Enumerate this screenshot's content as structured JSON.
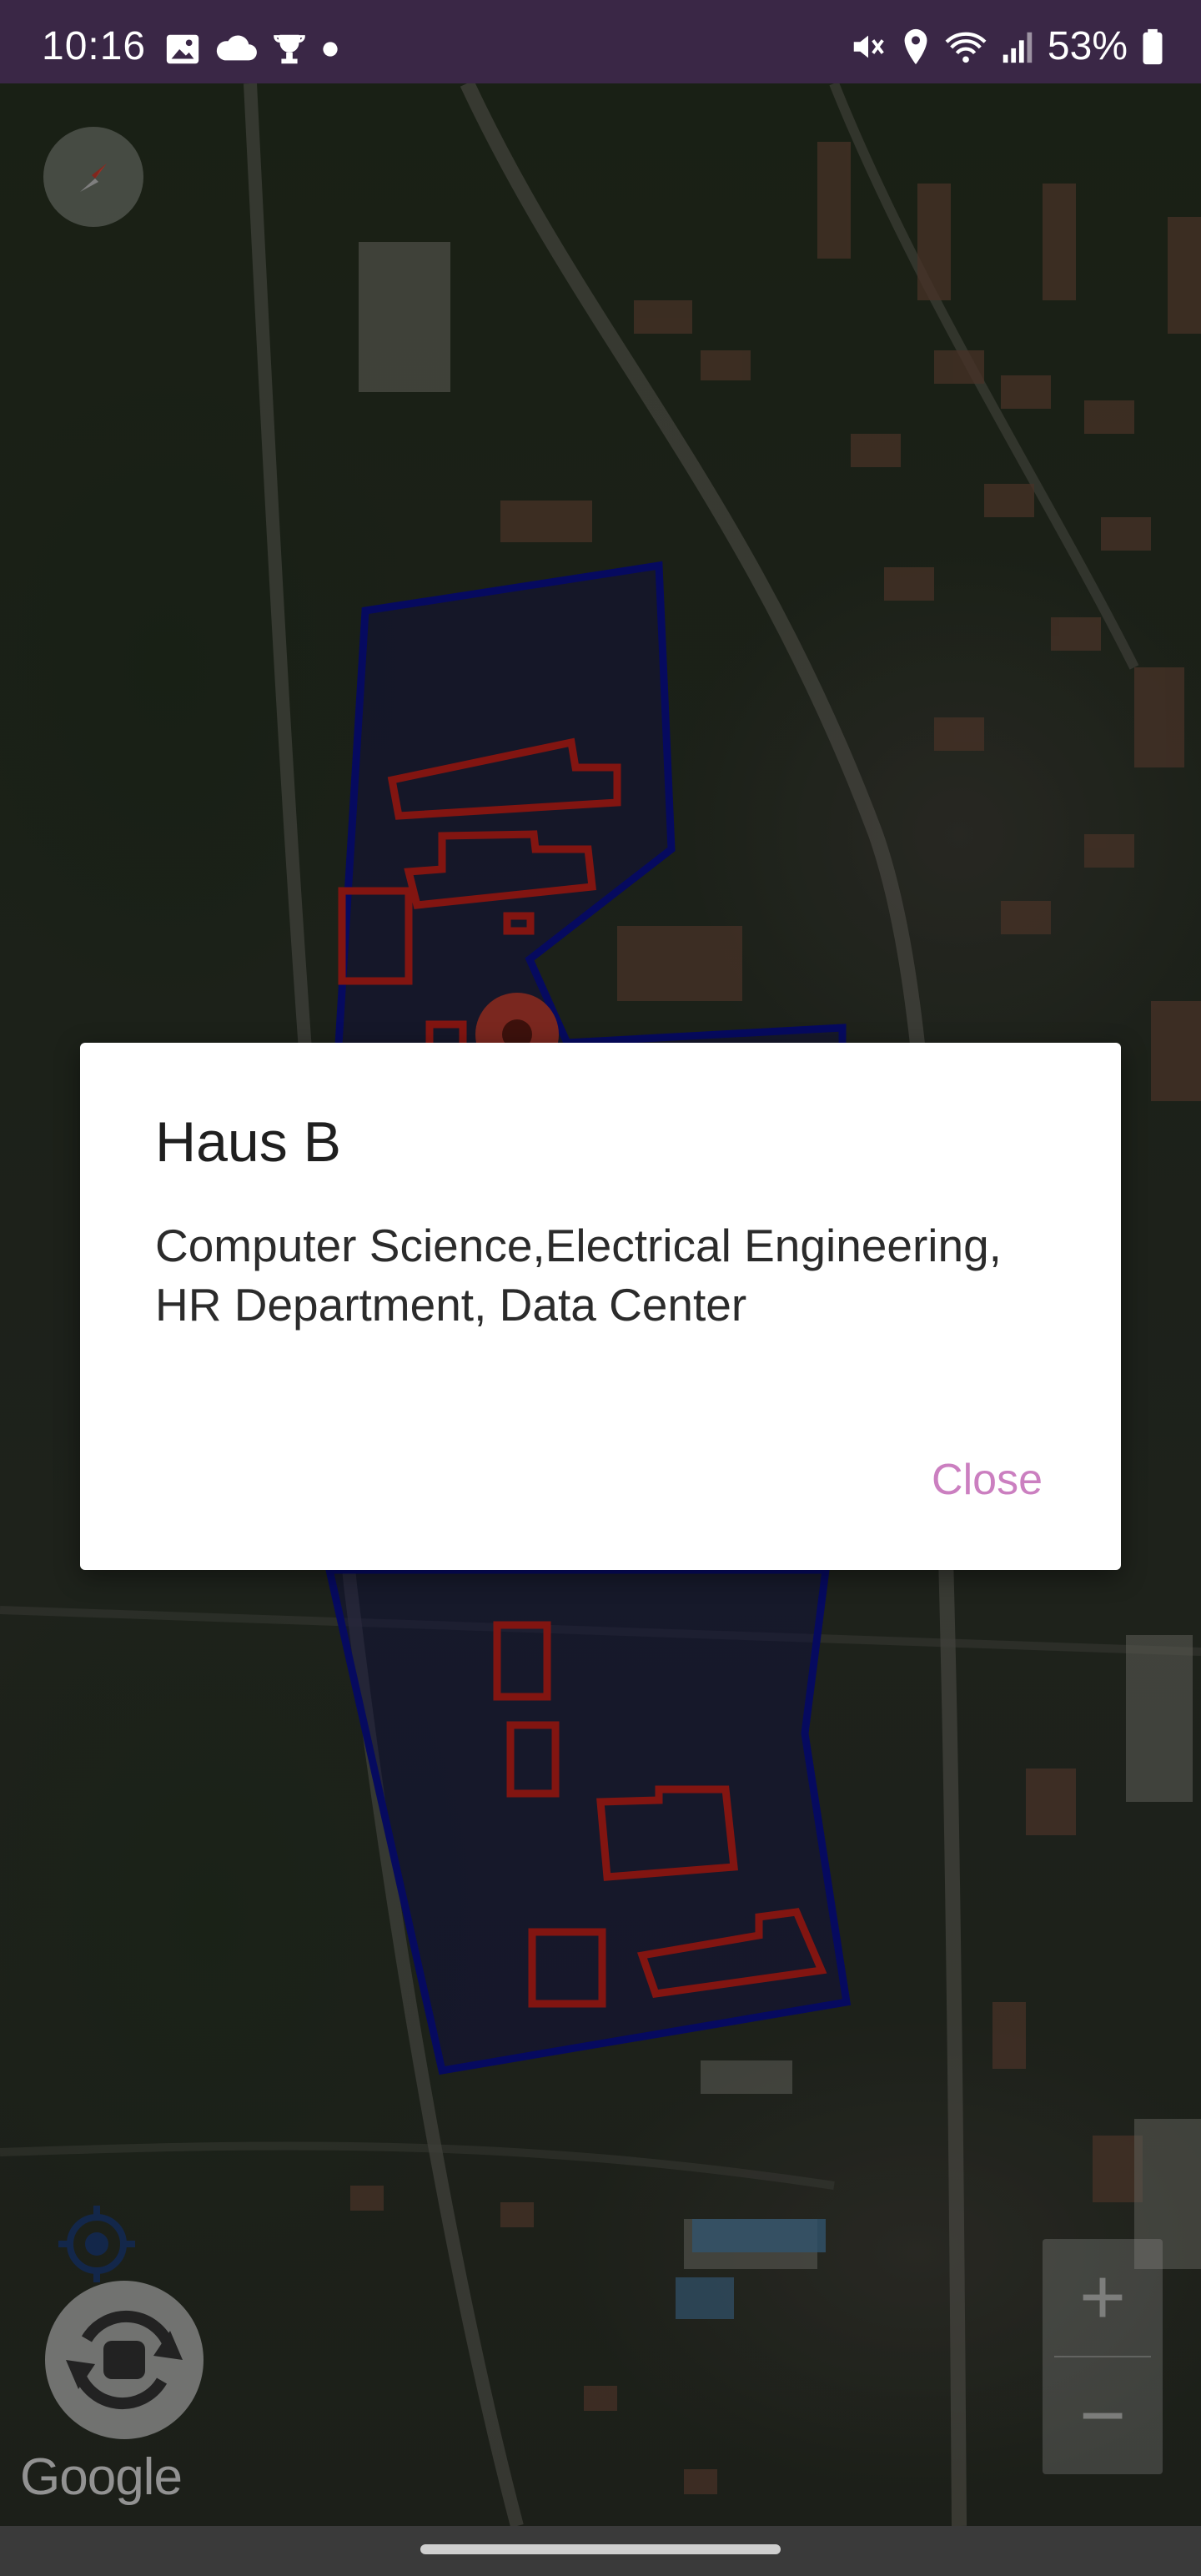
{
  "status_bar": {
    "time": "10:16",
    "left_icons": [
      "gallery-icon",
      "cloud-icon",
      "trophy-icon",
      "dot-icon"
    ],
    "right_icons": [
      "mute-icon",
      "location-icon",
      "wifi-icon",
      "signal-icon"
    ],
    "battery": "53%"
  },
  "map": {
    "attribution": "Google",
    "zoom_in_label": "+",
    "zoom_out_label": "−",
    "colors": {
      "campus_outline": "#0a0f8c",
      "building_outline": "#c0201a"
    }
  },
  "dialog": {
    "title": "Haus B",
    "message": "Computer Science,Electrical Engineering, HR Department, Data Center",
    "close_label": "Close",
    "accent": "#cb7fc0"
  }
}
